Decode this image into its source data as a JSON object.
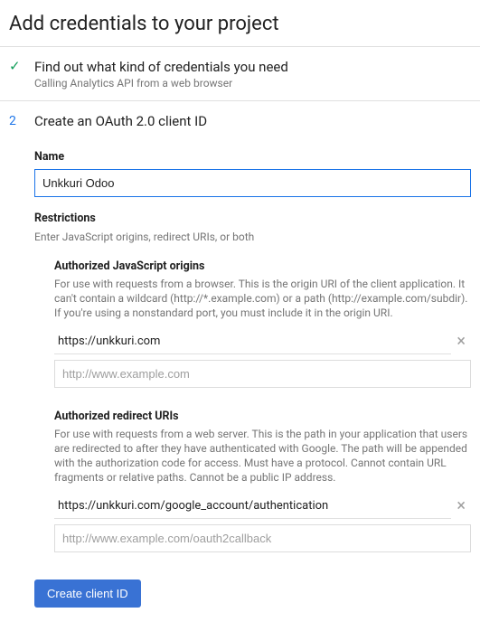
{
  "title": "Add credentials to your project",
  "step1": {
    "title": "Find out what kind of credentials you need",
    "subtitle": "Calling Analytics API from a web browser"
  },
  "step2": {
    "number": "2",
    "title": "Create an OAuth 2.0 client ID",
    "name_label": "Name",
    "name_value": "Unkkuri Odoo",
    "restrictions_label": "Restrictions",
    "restrictions_desc": "Enter JavaScript origins, redirect URIs, or both",
    "js_origins": {
      "heading": "Authorized JavaScript origins",
      "desc": "For use with requests from a browser. This is the origin URI of the client application. It can't contain a wildcard (http://*.example.com) or a path (http://example.com/subdir). If you're using a nonstandard port, you must include it in the origin URI.",
      "value": "https://unkkuri.com",
      "placeholder": "http://www.example.com"
    },
    "redirect_uris": {
      "heading": "Authorized redirect URIs",
      "desc": "For use with requests from a web server. This is the path in your application that users are redirected to after they have authenticated with Google. The path will be appended with the authorization code for access. Must have a protocol. Cannot contain URL fragments or relative paths. Cannot be a public IP address.",
      "value": "https://unkkuri.com/google_account/authentication",
      "placeholder": "http://www.example.com/oauth2callback"
    },
    "create_button": "Create client ID"
  }
}
